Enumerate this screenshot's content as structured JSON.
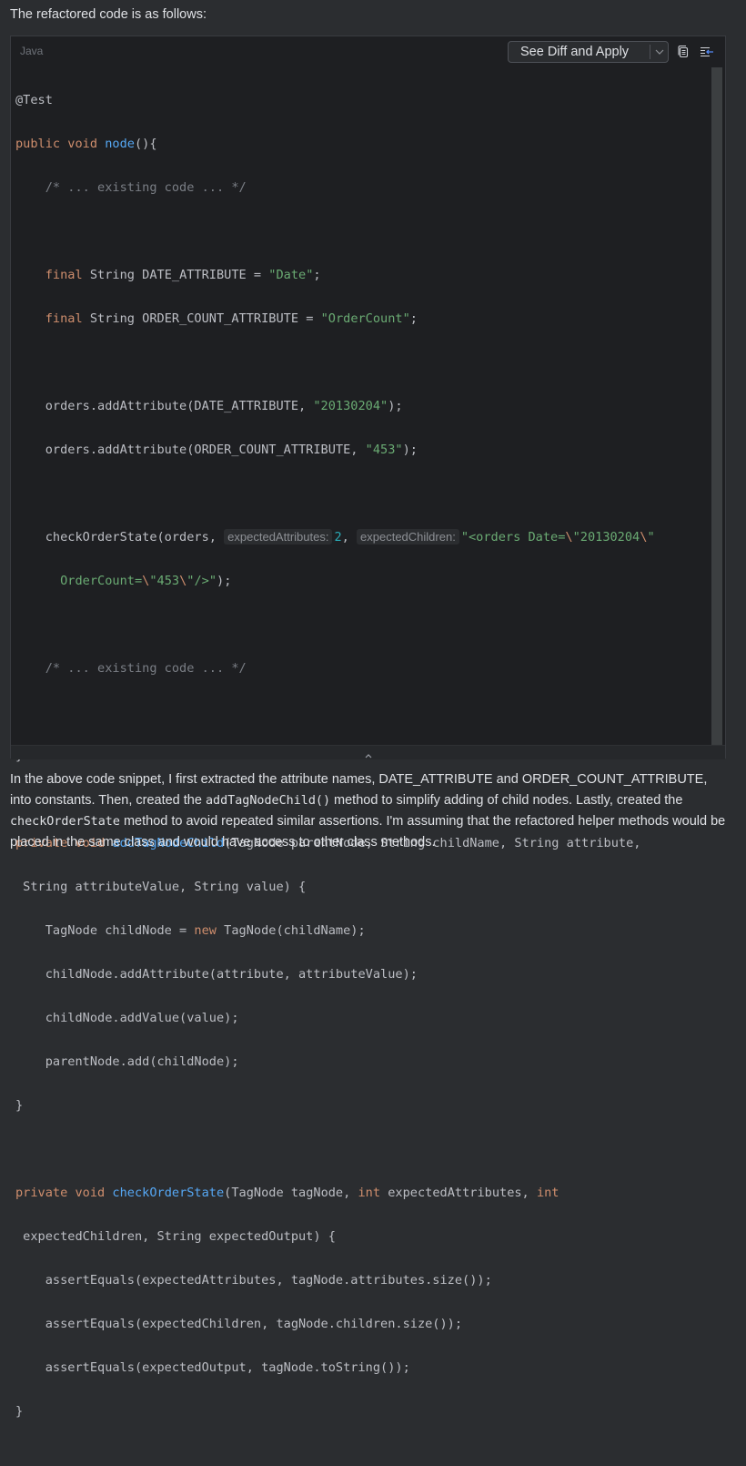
{
  "intro_text": "The refactored code is as follows:",
  "code_block": {
    "language": "Java",
    "apply_button_label": "See Diff and Apply",
    "icons": [
      "chevron-down-icon",
      "copy-icon",
      "insert-at-caret-icon",
      "chevron-up-icon"
    ],
    "colors": {
      "keyword": "#cf8e6d",
      "function": "#56a8f5",
      "string": "#6aab73",
      "comment": "#7a7e85",
      "number": "#2aacb8",
      "default": "#bcbec4",
      "background": "#1e1f22"
    },
    "lines": {
      "l1": "@Test",
      "l2_kw": "public void ",
      "l2_fn": "node",
      "l2_rest": "(){",
      "l3": "    /* ... existing code ... */",
      "l5_kw": "final",
      "l5_rest": " String DATE_ATTRIBUTE = ",
      "l5_str": "\"Date\"",
      "l5_end": ";",
      "l6_kw": "final",
      "l6_rest": " String ORDER_COUNT_ATTRIBUTE = ",
      "l6_str": "\"OrderCount\"",
      "l6_end": ";",
      "l8_a": "    orders.addAttribute(DATE_ATTRIBUTE, ",
      "l8_str": "\"20130204\"",
      "l8_end": ");",
      "l9_a": "    orders.addAttribute(ORDER_COUNT_ATTRIBUTE, ",
      "l9_str": "\"453\"",
      "l9_end": ");",
      "l11_a": "    checkOrderState(orders, ",
      "l11_hint1": "expectedAttributes:",
      "l11_num": "2",
      "l11_comma": ", ",
      "l11_hint2": "expectedChildren:",
      "l11_str1": "\"<orders Date=",
      "l11_esc1": "\\",
      "l11_str2": "\"20130204",
      "l11_esc2": "\\",
      "l11_str3": "\"",
      "l12_str1": "      OrderCount=",
      "l12_esc1": "\\",
      "l12_str2": "\"453",
      "l12_esc2": "\\",
      "l12_str3": "\"/>\"",
      "l12_end": ");",
      "l14": "    /* ... existing code ... */",
      "l16": "}",
      "l18_kw": "private void ",
      "l18_fn": "addTagNodeChild",
      "l18_rest": "(TagNode parentNode, String childName, String attribute,",
      "l19": " String attributeValue, String value) {",
      "l20_a": "    TagNode childNode = ",
      "l20_kw": "new",
      "l20_b": " TagNode(childName);",
      "l21": "    childNode.addAttribute(attribute, attributeValue);",
      "l22": "    childNode.addValue(value);",
      "l23": "    parentNode.add(childNode);",
      "l24": "}",
      "l26_kw": "private void ",
      "l26_fn": "checkOrderState",
      "l26_a": "(TagNode tagNode, ",
      "l26_kw2": "int",
      "l26_b": " expectedAttributes, ",
      "l26_kw3": "int",
      "l27": " expectedChildren, String expectedOutput) {",
      "l28": "    assertEquals(expectedAttributes, tagNode.attributes.size());",
      "l29": "    assertEquals(expectedChildren, tagNode.children.size());",
      "l30": "    assertEquals(expectedOutput, tagNode.toString());",
      "l31": "}"
    }
  },
  "outro": {
    "p1": "In the above code snippet, I first extracted the attribute names, DATE_ATTRIBUTE and ORDER_COUNT_ATTRIBUTE, into constants. Then, created the ",
    "code1": "addTagNodeChild()",
    "p2": " method to simplify adding of child nodes. Lastly, created the ",
    "code2": "checkOrderState",
    "p3": " method to avoid repeated similar assertions. I'm assuming that the refactored helper methods would be placed in the same class and would have access to other class methods."
  }
}
